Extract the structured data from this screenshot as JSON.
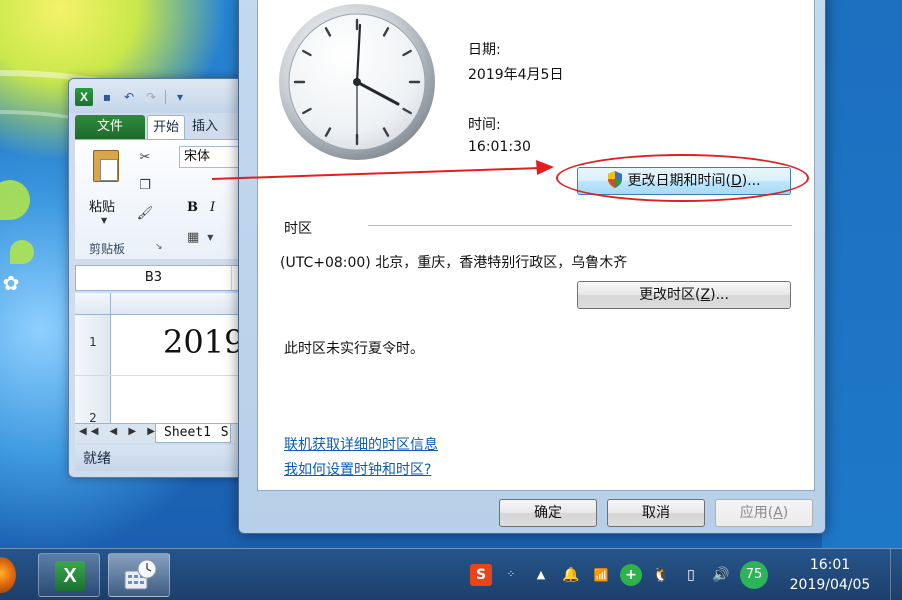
{
  "excel": {
    "app_icon_letter": "X",
    "tabs": {
      "file": "文件",
      "home": "开始",
      "insert": "插入"
    },
    "font_name": "宋体",
    "paste_label": "粘贴",
    "clipboard_label": "剪贴板",
    "bold": "B",
    "italic": "I",
    "name_box": "B3",
    "row1": "1",
    "row2": "2",
    "cell_value": "2019",
    "sheet_tab": "Sheet1",
    "sheet_tab_partial": "S",
    "status": "就绪"
  },
  "dialog": {
    "date_label": "日期:",
    "date_value": "2019年4月5日",
    "time_label": "时间:",
    "time_value": "16:01:30",
    "change_datetime_button": {
      "text": "更改日期和时间(",
      "hotkey": "D",
      "suffix": ")..."
    },
    "timezone_header": "时区",
    "timezone_value": "(UTC+08:00) 北京，重庆，香港特别行政区，乌鲁木齐",
    "change_timezone_button": {
      "text": "更改时区(",
      "hotkey": "Z",
      "suffix": ")..."
    },
    "dst_note": "此时区未实行夏令时。",
    "link_online_tz": "联机获取详细的时区信息",
    "link_howto": "我如何设置时钟和时区?",
    "ok": "确定",
    "cancel": "取消",
    "apply": {
      "text": "应用(",
      "hotkey": "A",
      "suffix": ")"
    }
  },
  "taskbar": {
    "clock_time": "16:01",
    "clock_date": "2019/04/05",
    "tray_badge": "75",
    "sogou": "S"
  },
  "colors": {
    "annotation_red": "#e02020",
    "link_blue": "#0a5fb4"
  }
}
